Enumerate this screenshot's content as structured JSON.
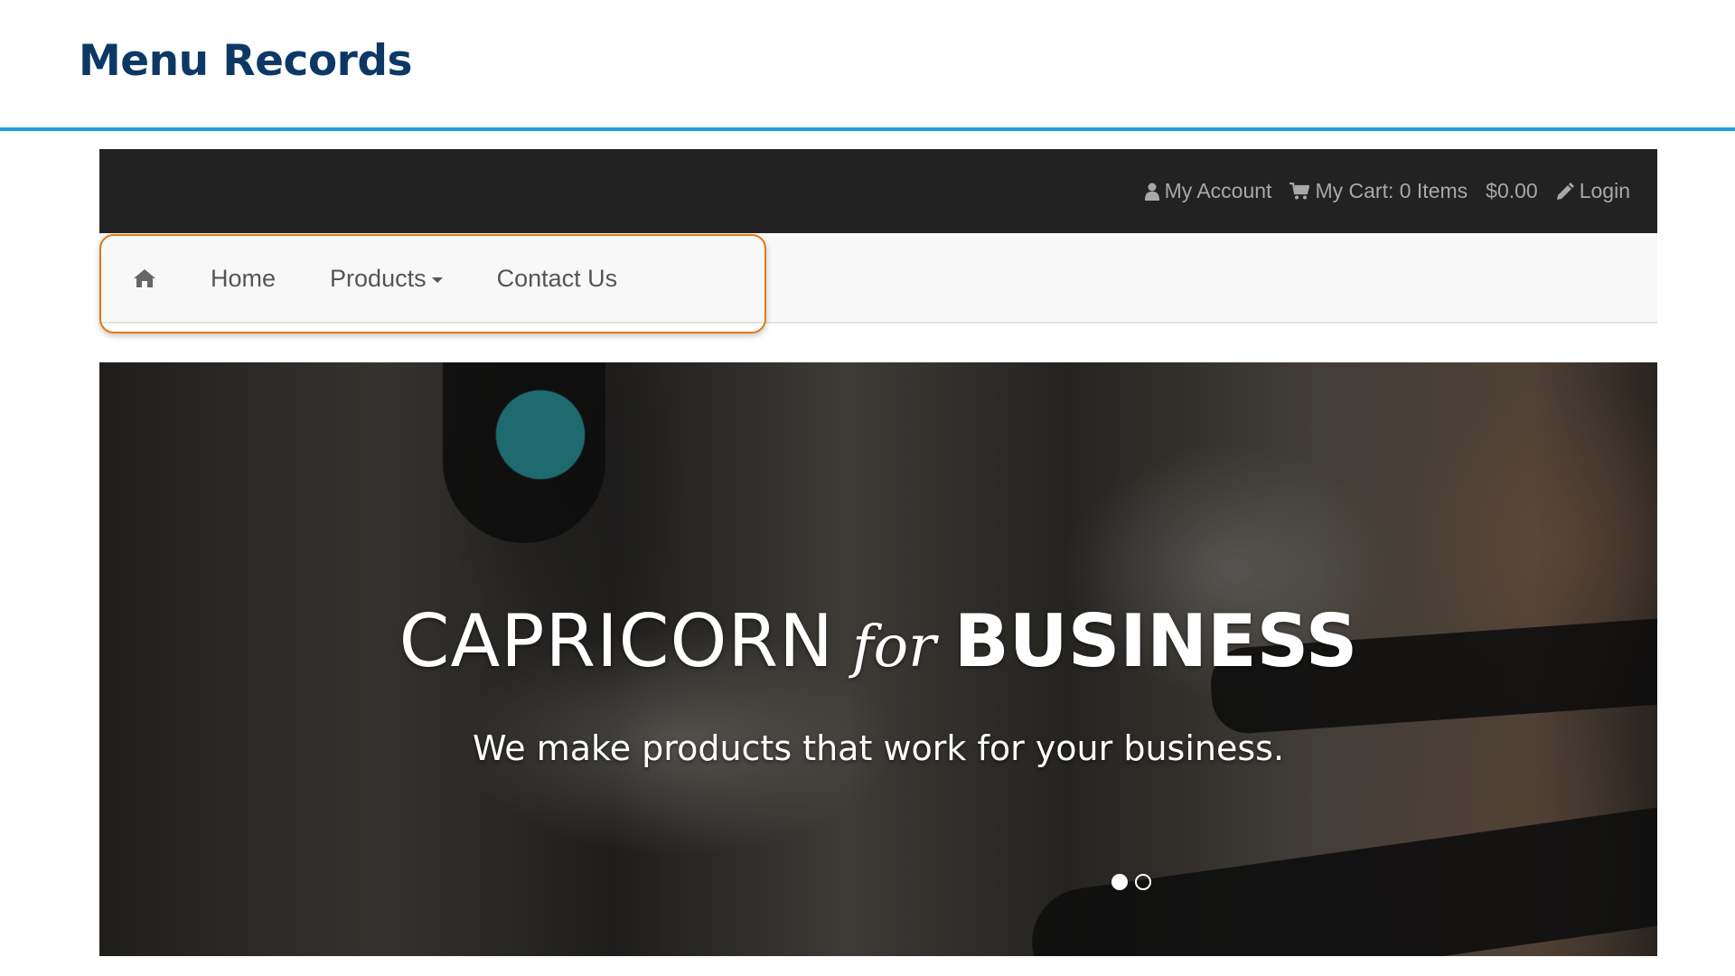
{
  "slide": {
    "title": "Menu Records"
  },
  "topbar": {
    "account": {
      "label": "My Account",
      "icon": "user-icon"
    },
    "cart": {
      "label": "My Cart: 0 Items",
      "total": "$0.00",
      "icon": "shopping-cart-icon"
    },
    "login": {
      "label": "Login",
      "icon": "pencil-icon"
    }
  },
  "nav": {
    "home_icon": "home-icon",
    "items": [
      {
        "label": "Home"
      },
      {
        "label": "Products",
        "has_dropdown": true
      },
      {
        "label": "Contact Us"
      }
    ],
    "highlight_color": "#e07a14"
  },
  "hero": {
    "heading_part1": "CAPRICORN",
    "heading_for": "for",
    "heading_part2": "BUSINESS",
    "subheading": "We make products that work for your business.",
    "slides_total": 2,
    "active_slide": 1
  },
  "colors": {
    "title": "#0d3866",
    "rule": "#1ba0d8",
    "topbar_bg": "#222222",
    "navbar_bg": "#f8f8f8"
  }
}
